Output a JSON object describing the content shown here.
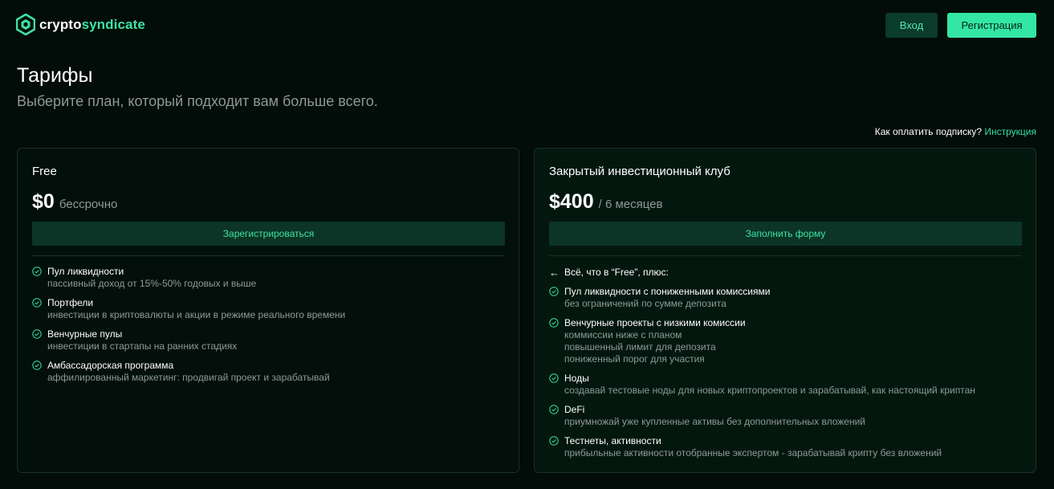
{
  "header": {
    "logo_part1": "crypto",
    "logo_part2": "syndicate",
    "login_label": "Вход",
    "register_label": "Регистрация"
  },
  "page": {
    "title": "Тарифы",
    "subtitle": "Выберите план, который подходит вам больше всего.",
    "pay_hint": "Как оплатить подписку?",
    "pay_link": "Инструкция"
  },
  "plans": [
    {
      "name": "Free",
      "price": "$0",
      "period": "бессрочно",
      "button_label": "Зарегистрироваться",
      "features": [
        {
          "title": "Пул ликвидности",
          "desc": [
            "пассивный доход от 15%-50% годовых и выше"
          ]
        },
        {
          "title": "Портфели",
          "desc": [
            "инвестиции в криптовалюты и акции в режиме реального времени"
          ]
        },
        {
          "title": "Венчурные пулы",
          "desc": [
            "инвестиции в стартапы на ранних стадиях"
          ]
        },
        {
          "title": "Амбассадорская программа",
          "desc": [
            "аффилированный маркетинг: продвигай проект и зарабатывай"
          ]
        }
      ]
    },
    {
      "name": "Закрытый инвестиционный клуб",
      "price": "$400",
      "period": "/ 6 месяцев",
      "button_label": "Заполнить форму",
      "lead": "Всё, что в “Free”, плюс:",
      "features": [
        {
          "title": "Пул ликвидности с пониженными комиссиями",
          "desc": [
            "без ограничений по сумме депозита"
          ]
        },
        {
          "title": "Венчурные проекты с низкими комиссии",
          "desc": [
            "коммиссии ниже с планом",
            "повышенный лимит для депозита",
            "пониженный порог для участия"
          ]
        },
        {
          "title": "Ноды",
          "desc": [
            "создавай тестовые ноды для новых криптопроектов и зарабатывай, как настоящий криптан"
          ]
        },
        {
          "title": "DeFi",
          "desc": [
            "приумножай уже купленные активы без дополнительных вложений"
          ]
        },
        {
          "title": "Тестнеты, активности",
          "desc": [
            "прибыльные активности отобранные экспертом - зарабатывай крипту без вложений"
          ]
        }
      ]
    }
  ],
  "colors": {
    "background": "#020c08",
    "accent": "#33e6a4",
    "muted_text": "#8f9a96"
  }
}
